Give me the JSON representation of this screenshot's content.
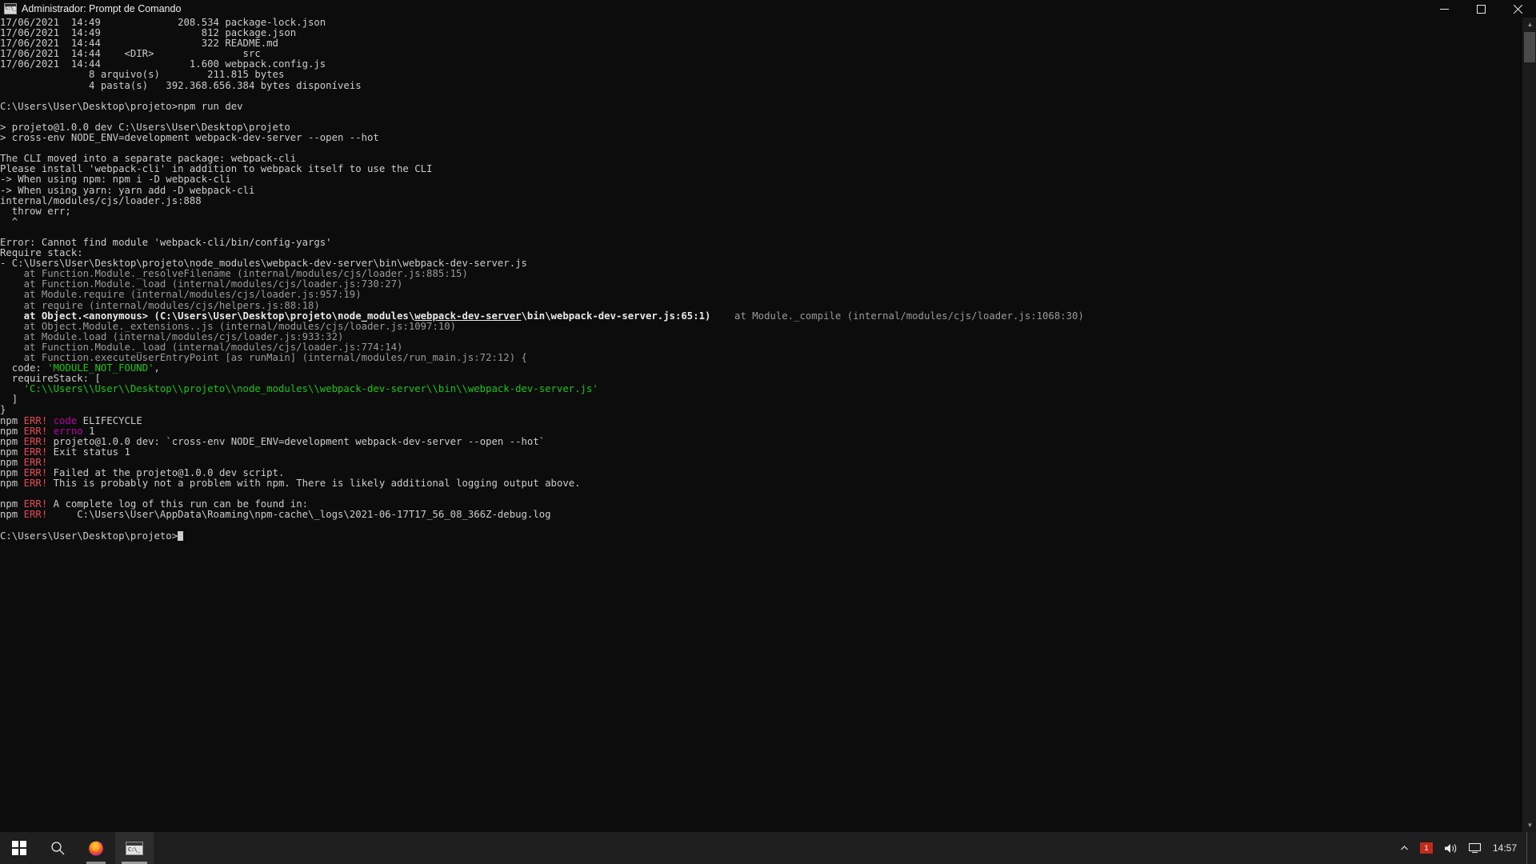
{
  "window": {
    "title": "Administrador: Prompt de Comando",
    "icon": "command-prompt-icon",
    "minimize_label": "—",
    "maximize_label": "❐",
    "close_label": "✕"
  },
  "console": {
    "lines": [
      {
        "id": 0,
        "segments": [
          {
            "text": "17/06/2021  14:49             208.534 package-lock.json",
            "style": "white"
          }
        ]
      },
      {
        "id": 1,
        "segments": [
          {
            "text": "17/06/2021  14:49                 812 package.json",
            "style": "white"
          }
        ]
      },
      {
        "id": 2,
        "segments": [
          {
            "text": "17/06/2021  14:44                 322 README.md",
            "style": "white"
          }
        ]
      },
      {
        "id": 3,
        "segments": [
          {
            "text": "17/06/2021  14:44    <DIR>               src",
            "style": "white"
          }
        ]
      },
      {
        "id": 4,
        "segments": [
          {
            "text": "17/06/2021  14:44               1.600 webpack.config.js",
            "style": "white"
          }
        ]
      },
      {
        "id": 5,
        "segments": [
          {
            "text": "               8 arquivo(s)        211.815 bytes",
            "style": "white"
          }
        ]
      },
      {
        "id": 6,
        "segments": [
          {
            "text": "               4 pasta(s)   392.368.656.384 bytes disponíveis",
            "style": "white"
          }
        ]
      },
      {
        "id": 7,
        "segments": [
          {
            "text": "",
            "style": "white"
          }
        ]
      },
      {
        "id": 8,
        "segments": [
          {
            "text": "C:\\Users\\User\\Desktop\\projeto>npm run dev",
            "style": "white"
          }
        ]
      },
      {
        "id": 9,
        "segments": [
          {
            "text": "",
            "style": "white"
          }
        ]
      },
      {
        "id": 10,
        "segments": [
          {
            "text": "> projeto@1.0.0 dev C:\\Users\\User\\Desktop\\projeto",
            "style": "white"
          }
        ]
      },
      {
        "id": 11,
        "segments": [
          {
            "text": "> cross-env NODE_ENV=development webpack-dev-server --open --hot",
            "style": "white"
          }
        ]
      },
      {
        "id": 12,
        "segments": [
          {
            "text": "",
            "style": "white"
          }
        ]
      },
      {
        "id": 13,
        "segments": [
          {
            "text": "The CLI moved into a separate package: webpack-cli",
            "style": "white"
          }
        ]
      },
      {
        "id": 14,
        "segments": [
          {
            "text": "Please install 'webpack-cli' in addition to webpack itself to use the CLI",
            "style": "white"
          }
        ]
      },
      {
        "id": 15,
        "segments": [
          {
            "text": "-> When using npm: npm i -D webpack-cli",
            "style": "white"
          }
        ]
      },
      {
        "id": 16,
        "segments": [
          {
            "text": "-> When using yarn: yarn add -D webpack-cli",
            "style": "white"
          }
        ]
      },
      {
        "id": 17,
        "segments": [
          {
            "text": "internal/modules/cjs/loader.js:888",
            "style": "white"
          }
        ]
      },
      {
        "id": 18,
        "segments": [
          {
            "text": "  throw err;",
            "style": "white"
          }
        ]
      },
      {
        "id": 19,
        "segments": [
          {
            "text": "  ^",
            "style": "white"
          }
        ]
      },
      {
        "id": 20,
        "segments": [
          {
            "text": "",
            "style": "white"
          }
        ]
      },
      {
        "id": 21,
        "segments": [
          {
            "text": "Error: Cannot find module 'webpack-cli/bin/config-yargs'",
            "style": "white"
          }
        ]
      },
      {
        "id": 22,
        "segments": [
          {
            "text": "Require stack:",
            "style": "white"
          }
        ]
      },
      {
        "id": 23,
        "segments": [
          {
            "text": "- C:\\Users\\User\\Desktop\\projeto\\node_modules\\webpack-dev-server\\bin\\webpack-dev-server.js",
            "style": "white"
          }
        ]
      },
      {
        "id": 24,
        "segments": [
          {
            "text": "    at Function.Module._resolveFilename (internal/modules/cjs/loader.js:885:15)",
            "style": "dim"
          }
        ]
      },
      {
        "id": 25,
        "segments": [
          {
            "text": "    at Function.Module._load (internal/modules/cjs/loader.js:730:27)",
            "style": "dim"
          }
        ]
      },
      {
        "id": 26,
        "segments": [
          {
            "text": "    at Module.require (internal/modules/cjs/loader.js:957:19)",
            "style": "dim"
          }
        ]
      },
      {
        "id": 27,
        "segments": [
          {
            "text": "    at require (internal/modules/cjs/helpers.js:88:18)",
            "style": "dim"
          }
        ]
      },
      {
        "id": 28,
        "segments": [
          {
            "text": "    at Object.<anonymous> (C:\\Users\\User\\Desktop\\projeto\\node_modules\\",
            "style": "bold"
          },
          {
            "text": "webpack-dev-server",
            "style": "bold-underline"
          },
          {
            "text": "\\bin\\webpack-dev-server.js:65:1)",
            "style": "bold"
          },
          {
            "text": "    at Module._compile (internal/modules/cjs/loader.js:1068:30)",
            "style": "dim"
          }
        ]
      },
      {
        "id": 29,
        "segments": [
          {
            "text": "    at Object.Module._extensions..js (internal/modules/cjs/loader.js:1097:10)",
            "style": "dim"
          }
        ]
      },
      {
        "id": 30,
        "segments": [
          {
            "text": "    at Module.load (internal/modules/cjs/loader.js:933:32)",
            "style": "dim"
          }
        ]
      },
      {
        "id": 31,
        "segments": [
          {
            "text": "    at Function.Module._load (internal/modules/cjs/loader.js:774:14)",
            "style": "dim"
          }
        ]
      },
      {
        "id": 32,
        "segments": [
          {
            "text": "    at Function.executeUserEntryPoint [as runMain] (internal/modules/run_main.js:72:12) {",
            "style": "dim"
          }
        ]
      },
      {
        "id": 33,
        "segments": [
          {
            "text": "  code: ",
            "style": "white"
          },
          {
            "text": "'MODULE_NOT_FOUND'",
            "style": "green"
          },
          {
            "text": ",",
            "style": "white"
          }
        ]
      },
      {
        "id": 34,
        "segments": [
          {
            "text": "  requireStack: [",
            "style": "white"
          }
        ]
      },
      {
        "id": 35,
        "segments": [
          {
            "text": "    ",
            "style": "white"
          },
          {
            "text": "'C:\\\\Users\\\\User\\\\Desktop\\\\projeto\\\\node_modules\\\\webpack-dev-server\\\\bin\\\\webpack-dev-server.js'",
            "style": "green"
          }
        ]
      },
      {
        "id": 36,
        "segments": [
          {
            "text": "  ]",
            "style": "white"
          }
        ]
      },
      {
        "id": 37,
        "segments": [
          {
            "text": "}",
            "style": "white"
          }
        ]
      },
      {
        "id": 38,
        "segments": [
          {
            "text": "npm ",
            "style": "white"
          },
          {
            "text": "ERR!",
            "style": "red"
          },
          {
            "text": " ",
            "style": "white"
          },
          {
            "text": "code",
            "style": "magenta"
          },
          {
            "text": " ELIFECYCLE",
            "style": "white"
          }
        ]
      },
      {
        "id": 39,
        "segments": [
          {
            "text": "npm ",
            "style": "white"
          },
          {
            "text": "ERR!",
            "style": "red"
          },
          {
            "text": " ",
            "style": "white"
          },
          {
            "text": "errno",
            "style": "magenta"
          },
          {
            "text": " 1",
            "style": "white"
          }
        ]
      },
      {
        "id": 40,
        "segments": [
          {
            "text": "npm ",
            "style": "white"
          },
          {
            "text": "ERR!",
            "style": "red"
          },
          {
            "text": " projeto@1.0.0 dev: `cross-env NODE_ENV=development webpack-dev-server --open --hot`",
            "style": "white"
          }
        ]
      },
      {
        "id": 41,
        "segments": [
          {
            "text": "npm ",
            "style": "white"
          },
          {
            "text": "ERR!",
            "style": "red"
          },
          {
            "text": " Exit status 1",
            "style": "white"
          }
        ]
      },
      {
        "id": 42,
        "segments": [
          {
            "text": "npm ",
            "style": "white"
          },
          {
            "text": "ERR!",
            "style": "red"
          }
        ]
      },
      {
        "id": 43,
        "segments": [
          {
            "text": "npm ",
            "style": "white"
          },
          {
            "text": "ERR!",
            "style": "red"
          },
          {
            "text": " Failed at the projeto@1.0.0 dev script.",
            "style": "white"
          }
        ]
      },
      {
        "id": 44,
        "segments": [
          {
            "text": "npm ",
            "style": "white"
          },
          {
            "text": "ERR!",
            "style": "red"
          },
          {
            "text": " This is probably not a problem with npm. There is likely additional logging output above.",
            "style": "white"
          }
        ]
      },
      {
        "id": 45,
        "segments": [
          {
            "text": "",
            "style": "white"
          }
        ]
      },
      {
        "id": 46,
        "segments": [
          {
            "text": "npm ",
            "style": "white"
          },
          {
            "text": "ERR!",
            "style": "red"
          },
          {
            "text": " A complete log of this run can be found in:",
            "style": "white"
          }
        ]
      },
      {
        "id": 47,
        "segments": [
          {
            "text": "npm ",
            "style": "white"
          },
          {
            "text": "ERR!",
            "style": "red"
          },
          {
            "text": "     C:\\Users\\User\\AppData\\Roaming\\npm-cache\\_logs\\2021-06-17T17_56_08_366Z-debug.log",
            "style": "white"
          }
        ]
      },
      {
        "id": 48,
        "segments": [
          {
            "text": "",
            "style": "white"
          }
        ]
      },
      {
        "id": 49,
        "segments": [
          {
            "text": "C:\\Users\\User\\Desktop\\projeto>",
            "style": "white",
            "cursor": true
          }
        ]
      }
    ]
  },
  "scrollbar": {
    "up_arrow": "▲",
    "down_arrow": "▼"
  },
  "taskbar": {
    "start_label": "Start",
    "search_label": "Search",
    "items": [
      {
        "name": "firefox",
        "label": "Mozilla Firefox",
        "state": "running"
      },
      {
        "name": "command-prompt",
        "label": "Administrador: Prompt de Comando",
        "state": "active"
      }
    ],
    "tray": {
      "notification_badge": "1",
      "volume_label": "Volume",
      "network_label": "Network",
      "time": "14:57"
    }
  },
  "colors": {
    "background": "#0c0c0c",
    "foreground": "#cccccc",
    "dim": "#9a9a9a",
    "green": "#16c60c",
    "red": "#e74856",
    "magenta": "#b4009e",
    "taskbar": "#1f1f1f"
  }
}
